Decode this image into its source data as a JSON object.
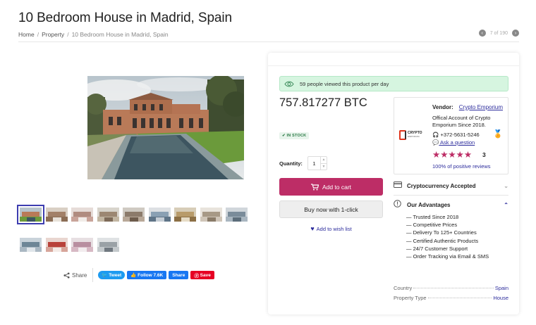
{
  "page": {
    "title": "10 Bedroom House in Madrid, Spain",
    "breadcrumb": [
      "Home",
      "Property",
      "10 Bedroom House in Madrid, Spain"
    ],
    "pager": "7 of 190"
  },
  "gallery": {
    "thumbnail_count": 13,
    "selected_index": 0
  },
  "share": {
    "label": "Share",
    "tweet": "Tweet",
    "follow": "Follow 7.6K",
    "share": "Share",
    "save": "Save"
  },
  "product": {
    "views_text": "59 people viewed this product per day",
    "price": "757.817277 BTC",
    "stock": "IN STOCK",
    "quantity_label": "Quantity:",
    "quantity": "1",
    "add_to_cart": "Add to cart",
    "buy_now": "Buy now with 1-click",
    "wishlist": "Add to wish list"
  },
  "vendor": {
    "label": "Vendor:",
    "name": "Crypto Emporium",
    "description": "Offical Account of Crypto Emporium Since 2018.",
    "phone": "+372-5631-5246",
    "ask": "Ask a question",
    "rating_stars": 5,
    "rating_count": "3",
    "reviews": "100% of positive reviews",
    "logo_text": "CRYPTO",
    "logo_subtext": "EMPORIUM"
  },
  "accordion": {
    "crypto": "Cryptocurrency Accepted",
    "advantages": "Our Advantages",
    "advantages_items": [
      "— Trusted Since 2018",
      "— Competitive Prices",
      "— Delivery To 125+ Countries",
      "— Certified Authentic Products",
      "— 24/7 Customer Support",
      "— Order Tracking via Email & SMS"
    ]
  },
  "attributes": [
    {
      "key": "Country",
      "value": "Spain"
    },
    {
      "key": "Property Type",
      "value": "House"
    }
  ],
  "colors": {
    "accent": "#bd2d66",
    "link": "#2c2c9c",
    "views_bg": "#d6f5e0"
  }
}
